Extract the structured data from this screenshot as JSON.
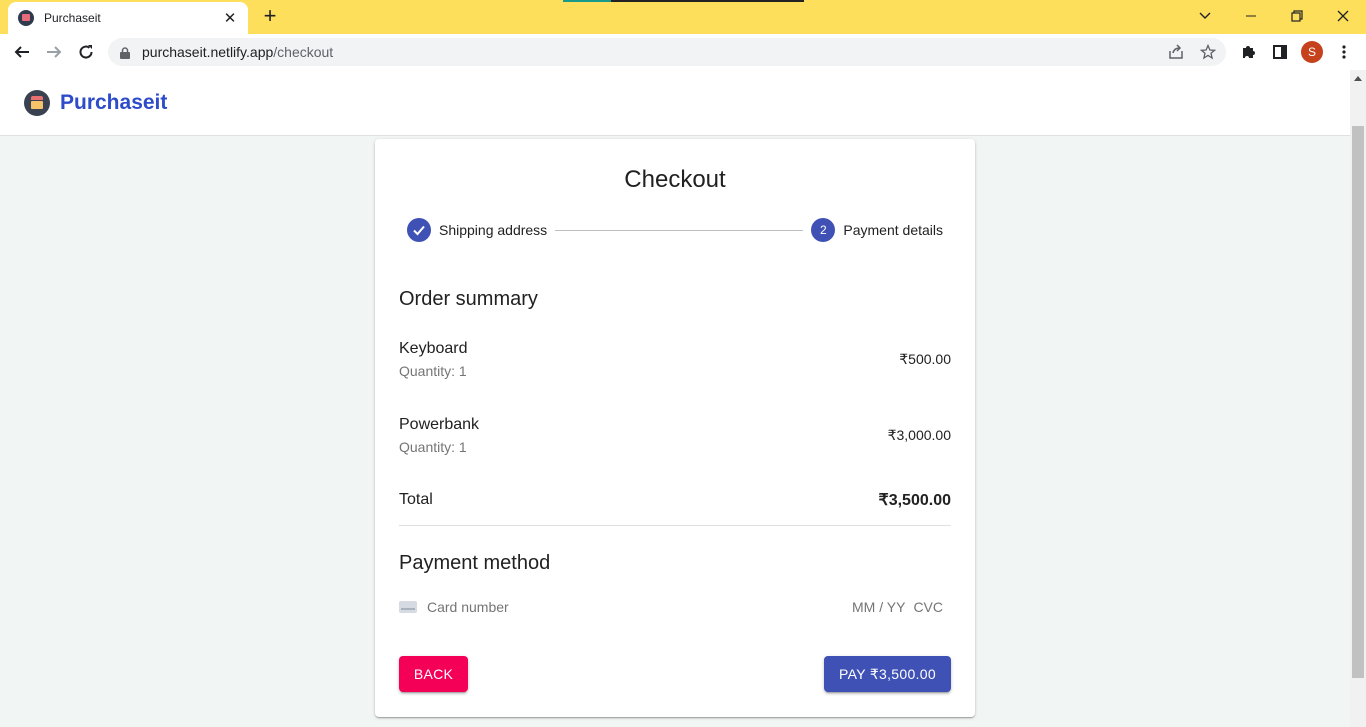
{
  "browser": {
    "tab_title": "Purchaseit",
    "url_host": "purchaseit.netlify.app",
    "url_path": "/checkout",
    "profile_initial": "S"
  },
  "app": {
    "brand": "Purchaseit"
  },
  "checkout": {
    "title": "Checkout",
    "steps": [
      {
        "label": "Shipping address",
        "status": "completed"
      },
      {
        "label": "Payment details",
        "number": "2",
        "status": "active"
      }
    ],
    "order_summary_title": "Order summary",
    "items": [
      {
        "name": "Keyboard",
        "quantity": "Quantity: 1",
        "price": "₹500.00"
      },
      {
        "name": "Powerbank",
        "quantity": "Quantity: 1",
        "price": "₹3,000.00"
      }
    ],
    "total_label": "Total",
    "total_amount": "₹3,500.00",
    "payment_method_title": "Payment method",
    "card_number_placeholder": "Card number",
    "expiry_placeholder": "MM / YY",
    "cvc_placeholder": "CVC",
    "back_label": "BACK",
    "pay_label": "PAY ₹3,500.00"
  },
  "colors": {
    "primary": "#3f51b5",
    "secondary": "#f50057",
    "brand": "#2e4cc9",
    "tabbar": "#fddf5c"
  }
}
